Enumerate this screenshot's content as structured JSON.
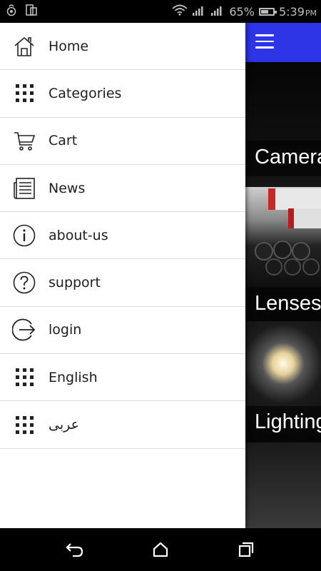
{
  "status_bar": {
    "battery_percent": "65%",
    "battery_level": 0.65,
    "time": "5:39",
    "ampm": "PM"
  },
  "drawer": {
    "items": [
      {
        "label": "Home",
        "icon": "home-icon"
      },
      {
        "label": "Categories",
        "icon": "grid-icon"
      },
      {
        "label": "Cart",
        "icon": "cart-icon"
      },
      {
        "label": "News",
        "icon": "newspaper-icon"
      },
      {
        "label": "about-us",
        "icon": "info-icon"
      },
      {
        "label": "support",
        "icon": "question-icon"
      },
      {
        "label": "login",
        "icon": "login-icon"
      },
      {
        "label": "English",
        "icon": "grid-icon"
      },
      {
        "label": "عربى",
        "icon": "grid-icon"
      }
    ]
  },
  "categories": {
    "tiles": [
      {
        "label": "Cameras"
      },
      {
        "label": "Lenses"
      },
      {
        "label": "Lighting"
      }
    ]
  },
  "colors": {
    "app_bar": "#2d35e6",
    "drawer_bg": "#ffffff",
    "divider": "#dcdcdc"
  }
}
